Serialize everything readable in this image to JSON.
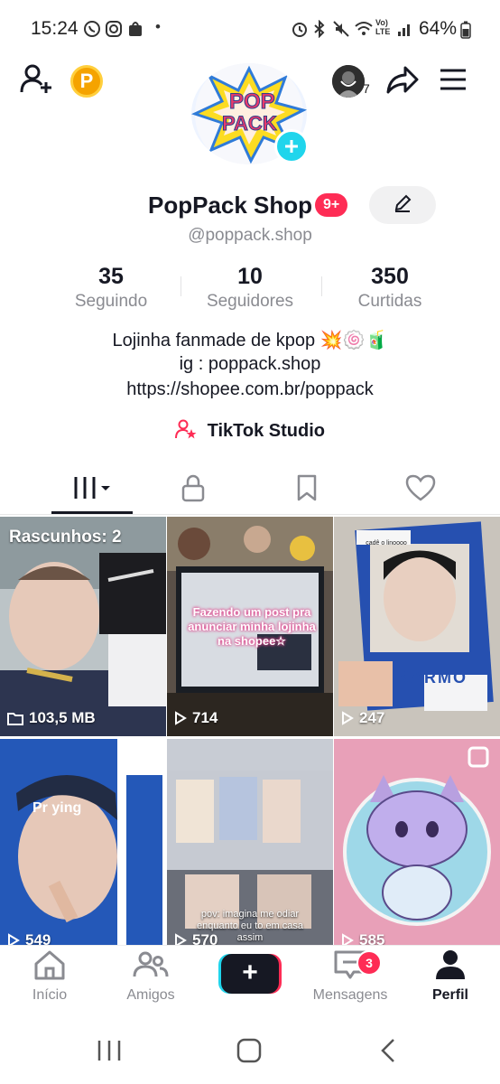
{
  "status_bar": {
    "time": "15:24",
    "battery": "64%",
    "dot": "•",
    "network": "Vo) LTE"
  },
  "header": {
    "add_friend_icon": "person-plus-icon",
    "coin_label": "P",
    "friends_count": "7",
    "share_icon": "share-icon",
    "menu_icon": "hamburger-menu-icon"
  },
  "logo": {
    "line1": "POP",
    "line2": "PACK"
  },
  "profile": {
    "name": "PopPack Shop",
    "notification_badge": "9+",
    "handle": "@poppack.shop",
    "stats": [
      {
        "value": "35",
        "label": "Seguindo"
      },
      {
        "value": "10",
        "label": "Seguidores"
      },
      {
        "value": "350",
        "label": "Curtidas"
      }
    ],
    "bio_line1": "Lojinha fanmade de kpop 💥🍥🧃",
    "bio_line2": "ig : poppack.shop",
    "bio_line3": "https://shopee.com.br/poppack",
    "studio_label": "TikTok Studio"
  },
  "tabs": [
    "videos-grid",
    "private",
    "saved",
    "liked"
  ],
  "grid": {
    "drafts_label": "Rascunhos: 2",
    "cells": [
      {
        "views": "103,5 MB",
        "kind": "drafts"
      },
      {
        "views": "714",
        "caption": "Fazendo um post pra anunciar minha lojinha na shopee☆"
      },
      {
        "views": "247"
      },
      {
        "views": "549",
        "print": "Pr  ying"
      },
      {
        "views": "570",
        "caption": "pov: imagina me odiar enquanto eu to em casa assim"
      },
      {
        "views": "585"
      }
    ],
    "banner_text": "cadê o linoooo",
    "tag_text": "KARMO"
  },
  "bottom_nav": {
    "items": [
      {
        "label": "Início",
        "icon": "home-icon"
      },
      {
        "label": "Amigos",
        "icon": "friends-icon"
      },
      {
        "label": "+",
        "icon": "create-icon"
      },
      {
        "label": "Mensagens",
        "icon": "inbox-icon"
      },
      {
        "label": "Perfil",
        "icon": "profile-icon"
      }
    ],
    "messages_badge": "3"
  },
  "colors": {
    "accent_red": "#fe2c55",
    "accent_cyan": "#20d5ec",
    "text_primary": "#161823",
    "text_secondary": "#8a8b91"
  }
}
